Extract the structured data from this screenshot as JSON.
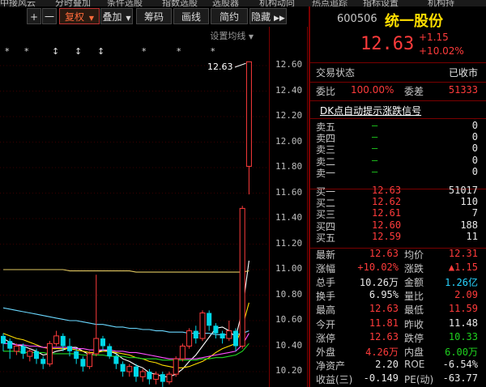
{
  "menubar": [
    "中接风云",
    "分时叠加",
    "条件选股",
    "指数选股",
    "选股器",
    "机构动向",
    "热点追踪",
    "指标设置",
    "机构持"
  ],
  "toolbar": {
    "plus": "+",
    "minus": "一",
    "fuquan": "复权",
    "fuquan_arrow": "▼",
    "overlay": "叠加",
    "overlay_arrow": "▼",
    "chips": "筹码",
    "draw": "画线",
    "brief": "简约",
    "hide": "隐藏",
    "hide_arrow": "▶▶"
  },
  "chart": {
    "settings_link": "设置均线",
    "settings_arrow": "▼",
    "high_label": "12.63",
    "price_ticks": [
      "12.60",
      "12.40",
      "12.20",
      "12.00",
      "11.80",
      "11.60",
      "11.40",
      "11.20",
      "11.00",
      "10.80",
      "10.60",
      "10.40",
      "10.20"
    ],
    "markers": [
      "*",
      "*",
      "↕",
      "↕",
      "↕",
      "*",
      "*",
      "*"
    ]
  },
  "quote": {
    "code": "600506",
    "name": "统一股份",
    "price": "12.63",
    "change": "+1.15",
    "change_pct": "+10.02%",
    "status_label": "交易状态",
    "status_value": "已收市",
    "weibi_label": "委比",
    "weibi_value": "100.00%",
    "weicha_label": "委差",
    "weicha_value": "51333",
    "dk_link": "DK点自动提示涨跌信号"
  },
  "sell_levels": [
    {
      "label": "卖五",
      "price": "—",
      "vol": "0"
    },
    {
      "label": "卖四",
      "price": "—",
      "vol": "0"
    },
    {
      "label": "卖三",
      "price": "—",
      "vol": "0"
    },
    {
      "label": "卖二",
      "price": "—",
      "vol": "0"
    },
    {
      "label": "卖一",
      "price": "—",
      "vol": "0"
    }
  ],
  "buy_levels": [
    {
      "label": "买一",
      "price": "12.63",
      "vol": "51017"
    },
    {
      "label": "买二",
      "price": "12.62",
      "vol": "110"
    },
    {
      "label": "买三",
      "price": "12.61",
      "vol": "7"
    },
    {
      "label": "买四",
      "price": "12.60",
      "vol": "188"
    },
    {
      "label": "买五",
      "price": "12.59",
      "vol": "11"
    }
  ],
  "stats": [
    {
      "l1": "最新",
      "v1": "12.63",
      "c1": "red",
      "l2": "均价",
      "v2": "12.31",
      "c2": "red"
    },
    {
      "l1": "涨幅",
      "v1": "+10.02%",
      "c1": "red",
      "l2": "涨跌",
      "v2": "▲1.15",
      "c2": "red"
    },
    {
      "l1": "总手",
      "v1": "10.26万",
      "c1": "white",
      "l2": "金额",
      "v2": "1.26亿",
      "c2": "cyan"
    },
    {
      "l1": "换手",
      "v1": "6.95%",
      "c1": "white",
      "l2": "量比",
      "v2": "2.09",
      "c2": "red"
    },
    {
      "l1": "最高",
      "v1": "12.63",
      "c1": "red",
      "l2": "最低",
      "v2": "11.59",
      "c2": "red"
    },
    {
      "l1": "今开",
      "v1": "11.81",
      "c1": "red",
      "l2": "昨收",
      "v2": "11.48",
      "c2": "white"
    },
    {
      "l1": "涨停",
      "v1": "12.63",
      "c1": "red",
      "l2": "跌停",
      "v2": "10.33",
      "c2": "green"
    },
    {
      "l1": "外盘",
      "v1": "4.26万",
      "c1": "red",
      "l2": "内盘",
      "v2": "6.00万",
      "c2": "green"
    },
    {
      "l1": "净资产",
      "v1": "2.20",
      "c1": "white",
      "l2": "ROE",
      "v2": "-6.54%",
      "c2": "white"
    },
    {
      "l1": "收益(三)",
      "v1": "-0.149",
      "c1": "white",
      "l2": "PE(动)",
      "v2": "-63.77",
      "c2": "white"
    }
  ],
  "candles": [
    {
      "o": 10.48,
      "c": 10.42,
      "h": 10.5,
      "l": 10.36
    },
    {
      "o": 10.44,
      "c": 10.38,
      "h": 10.46,
      "l": 10.3
    },
    {
      "o": 10.36,
      "c": 10.4,
      "h": 10.42,
      "l": 10.33
    },
    {
      "o": 10.4,
      "c": 10.34,
      "h": 10.42,
      "l": 10.3
    },
    {
      "o": 10.32,
      "c": 10.36,
      "h": 10.38,
      "l": 10.28
    },
    {
      "o": 10.36,
      "c": 10.3,
      "h": 10.38,
      "l": 10.26
    },
    {
      "o": 10.3,
      "c": 10.26,
      "h": 10.32,
      "l": 10.22
    },
    {
      "o": 10.26,
      "c": 10.42,
      "h": 10.44,
      "l": 10.24
    },
    {
      "o": 10.42,
      "c": 10.48,
      "h": 10.52,
      "l": 10.4
    },
    {
      "o": 10.48,
      "c": 10.4,
      "h": 10.5,
      "l": 10.36
    },
    {
      "o": 10.4,
      "c": 10.36,
      "h": 10.46,
      "l": 10.32
    },
    {
      "o": 10.36,
      "c": 10.3,
      "h": 10.38,
      "l": 10.26
    },
    {
      "o": 10.3,
      "c": 10.24,
      "h": 10.32,
      "l": 10.2
    },
    {
      "o": 10.24,
      "c": 10.34,
      "h": 10.36,
      "l": 10.22
    },
    {
      "o": 10.34,
      "c": 10.46,
      "h": 10.96,
      "l": 10.32
    },
    {
      "o": 10.46,
      "c": 10.4,
      "h": 10.48,
      "l": 10.36
    },
    {
      "o": 10.4,
      "c": 10.32,
      "h": 10.42,
      "l": 10.3
    },
    {
      "o": 10.32,
      "c": 10.26,
      "h": 10.34,
      "l": 10.22
    },
    {
      "o": 10.26,
      "c": 10.2,
      "h": 10.28,
      "l": 10.16
    },
    {
      "o": 10.2,
      "c": 10.24,
      "h": 10.26,
      "l": 10.16
    },
    {
      "o": 10.24,
      "c": 10.16,
      "h": 10.26,
      "l": 10.12
    },
    {
      "o": 10.16,
      "c": 10.2,
      "h": 10.22,
      "l": 10.12
    },
    {
      "o": 10.2,
      "c": 10.14,
      "h": 10.22,
      "l": 10.1
    },
    {
      "o": 10.14,
      "c": 10.18,
      "h": 10.2,
      "l": 10.1
    },
    {
      "o": 10.18,
      "c": 10.12,
      "h": 10.2,
      "l": 10.08
    },
    {
      "o": 10.12,
      "c": 10.18,
      "h": 10.2,
      "l": 10.1
    },
    {
      "o": 10.18,
      "c": 10.3,
      "h": 10.32,
      "l": 10.16
    },
    {
      "o": 10.3,
      "c": 10.4,
      "h": 10.42,
      "l": 10.28
    },
    {
      "o": 10.4,
      "c": 10.52,
      "h": 10.54,
      "l": 10.38
    },
    {
      "o": 10.52,
      "c": 10.46,
      "h": 10.56,
      "l": 10.42
    },
    {
      "o": 10.46,
      "c": 10.66,
      "h": 10.68,
      "l": 10.44
    },
    {
      "o": 10.66,
      "c": 10.56,
      "h": 10.68,
      "l": 10.52
    },
    {
      "o": 10.56,
      "c": 10.5,
      "h": 10.58,
      "l": 10.46
    },
    {
      "o": 10.5,
      "c": 10.46,
      "h": 10.52,
      "l": 10.42
    },
    {
      "o": 10.46,
      "c": 10.52,
      "h": 10.6,
      "l": 10.44
    },
    {
      "o": 10.52,
      "c": 10.4,
      "h": 10.54,
      "l": 10.36
    },
    {
      "o": 10.4,
      "c": 11.48,
      "h": 11.5,
      "l": 10.38
    },
    {
      "o": 11.81,
      "c": 12.63,
      "h": 12.63,
      "l": 11.59
    }
  ],
  "ma_lines": [
    {
      "name": "MA5",
      "color": "#ffffff",
      "values": [
        10.46,
        10.43,
        10.41,
        10.4,
        10.38,
        10.36,
        10.33,
        10.34,
        10.36,
        10.37,
        10.39,
        10.39,
        10.36,
        10.33,
        10.35,
        10.37,
        10.36,
        10.34,
        10.3,
        10.28,
        10.25,
        10.23,
        10.19,
        10.18,
        10.16,
        10.16,
        10.18,
        10.22,
        10.28,
        10.33,
        10.4,
        10.47,
        10.54,
        10.55,
        10.52,
        10.47,
        10.68,
        11.07
      ]
    },
    {
      "name": "MA10",
      "color": "#ffde00",
      "values": [
        10.5,
        10.48,
        10.46,
        10.45,
        10.43,
        10.41,
        10.39,
        10.38,
        10.38,
        10.38,
        10.38,
        10.37,
        10.36,
        10.35,
        10.35,
        10.36,
        10.36,
        10.35,
        10.34,
        10.33,
        10.31,
        10.3,
        10.28,
        10.27,
        10.25,
        10.24,
        10.23,
        10.23,
        10.24,
        10.26,
        10.28,
        10.31,
        10.35,
        10.38,
        10.4,
        10.42,
        10.55,
        10.74
      ]
    },
    {
      "name": "MA20",
      "color": "#ff4fff",
      "values": [
        10.42,
        10.42,
        10.41,
        10.41,
        10.4,
        10.4,
        10.39,
        10.39,
        10.39,
        10.39,
        10.39,
        10.38,
        10.38,
        10.37,
        10.37,
        10.37,
        10.37,
        10.36,
        10.36,
        10.35,
        10.35,
        10.34,
        10.33,
        10.32,
        10.31,
        10.3,
        10.3,
        10.3,
        10.3,
        10.3,
        10.31,
        10.32,
        10.33,
        10.34,
        10.35,
        10.36,
        10.41,
        10.5
      ]
    },
    {
      "name": "MA30",
      "color": "#22d822",
      "values": [
        10.36,
        10.36,
        10.36,
        10.35,
        10.35,
        10.35,
        10.35,
        10.34,
        10.34,
        10.34,
        10.34,
        10.34,
        10.33,
        10.33,
        10.33,
        10.33,
        10.32,
        10.32,
        10.32,
        10.31,
        10.31,
        10.3,
        10.3,
        10.3,
        10.29,
        10.29,
        10.29,
        10.29,
        10.29,
        10.29,
        10.3,
        10.3,
        10.31,
        10.31,
        10.32,
        10.33,
        10.36,
        10.42
      ]
    },
    {
      "name": "MA60",
      "color": "#6ad8ff",
      "values": [
        10.7,
        10.69,
        10.68,
        10.67,
        10.66,
        10.65,
        10.64,
        10.63,
        10.62,
        10.61,
        10.6,
        10.6,
        10.59,
        10.58,
        10.57,
        10.57,
        10.56,
        10.55,
        10.55,
        10.54,
        10.54,
        10.53,
        10.53,
        10.52,
        10.52,
        10.51,
        10.51,
        10.51,
        10.5,
        10.5,
        10.5,
        10.5,
        10.49,
        10.49,
        10.49,
        10.49,
        10.5,
        10.52
      ]
    },
    {
      "name": "MA120",
      "color": "#e0c860",
      "values": [
        11.0,
        11.0,
        11.0,
        11.0,
        11.0,
        11.0,
        11.0,
        11.0,
        11.0,
        11.0,
        10.99,
        10.99,
        10.99,
        10.99,
        10.99,
        10.99,
        10.99,
        10.99,
        10.99,
        10.99,
        10.98,
        10.98,
        10.98,
        10.98,
        10.98,
        10.98,
        10.98,
        10.98,
        10.98,
        10.98,
        10.98,
        10.98,
        10.98,
        10.98,
        10.98,
        10.98,
        10.98,
        10.99
      ]
    }
  ],
  "colors": {
    "up": "#ff3b3b",
    "down": "#00d8e8",
    "border": "#7a0000"
  }
}
